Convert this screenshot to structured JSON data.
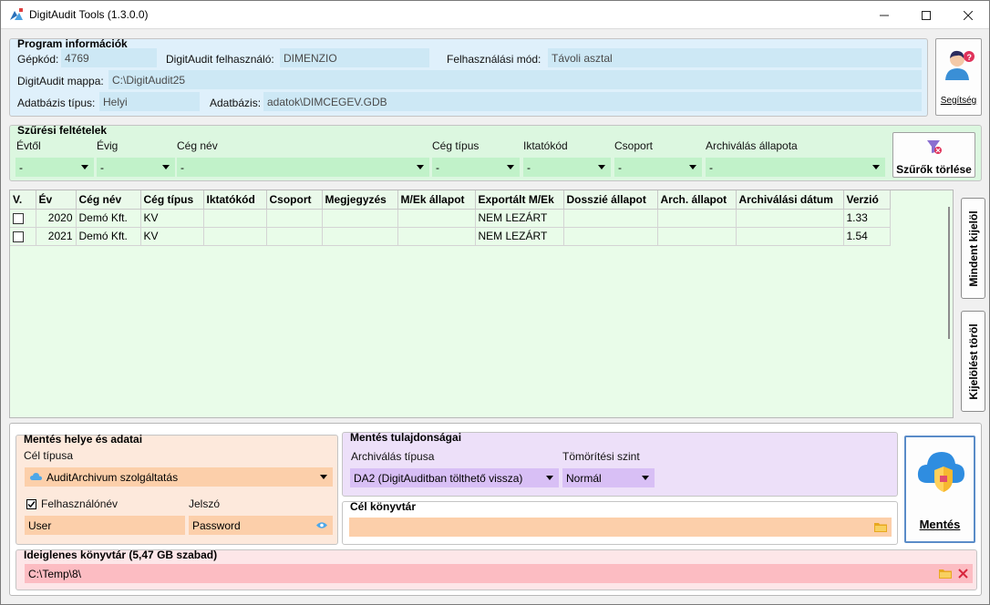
{
  "window": {
    "title": "DigitAudit Tools (1.3.0.0)"
  },
  "program_info": {
    "group_label": "Program információk",
    "machine_code_label": "Gépkód:",
    "machine_code": "4769",
    "user_label": "DigitAudit felhasználó:",
    "user": "DIMENZIO",
    "mode_label": "Felhasználási mód:",
    "mode": "Távoli asztal",
    "folder_label": "DigitAudit mappa:",
    "folder": "C:\\DigitAudit25",
    "db_type_label": "Adatbázis típus:",
    "db_type": "Helyi",
    "db_label": "Adatbázis:",
    "db": "adatok\\DIMCEGEV.GDB"
  },
  "help_button": {
    "label": "Segítség",
    "icon": "person-question-icon"
  },
  "filters": {
    "group_label": "Szűrési feltételek",
    "from_year_label": "Évtől",
    "from_year": "-",
    "to_year_label": "Évig",
    "to_year": "-",
    "company_label": "Cég név",
    "company": "-",
    "company_type_label": "Cég típus",
    "company_type": "-",
    "filing_code_label": "Iktatókód",
    "filing_code": "-",
    "group_filter_label": "Csoport",
    "group_filter": "-",
    "archive_status_label": "Archiválás állapota",
    "archive_status": "-",
    "clear_button": "Szűrők törlése"
  },
  "grid": {
    "columns": [
      "V.",
      "Év",
      "Cég név",
      "Cég típus",
      "Iktatókód",
      "Csoport",
      "Megjegyzés",
      "M/Ek állapot",
      "Exportált M/Ek",
      "Dosszié állapot",
      "Arch. állapot",
      "Archiválási dátum",
      "Verzió"
    ],
    "rows": [
      {
        "year": "2020",
        "company": "Demó Kft.",
        "type": "KV",
        "code": "",
        "group": "",
        "note": "",
        "mek_status": "",
        "exported": "NEM LEZÁRT",
        "dossier": "",
        "arch_status": "",
        "arch_date": "",
        "version": "1.33"
      },
      {
        "year": "2021",
        "company": "Demó Kft.",
        "type": "KV",
        "code": "",
        "group": "",
        "note": "",
        "mek_status": "",
        "exported": "NEM LEZÁRT",
        "dossier": "",
        "arch_status": "",
        "arch_date": "",
        "version": "1.54"
      }
    ],
    "select_all_button": "Mindent kijelöl",
    "clear_selection_button": "Kijelölést töröl"
  },
  "save_location": {
    "group_label": "Mentés helye és adatai",
    "target_type_label": "Cél típusa",
    "target_type": "AuditArchivum szolgáltatás",
    "username_checkbox_label": "Felhasználónév",
    "password_label": "Jelszó",
    "username": "User",
    "password": "Password"
  },
  "save_props": {
    "group_label": "Mentés tulajdonságai",
    "archive_type_label": "Archiválás típusa",
    "archive_type": "DA2 (DigitAuditban tölthető vissza)",
    "compression_label": "Tömörítési szint",
    "compression": "Normál"
  },
  "target_dir": {
    "group_label": "Cél könyvtár",
    "value": ""
  },
  "save_button": {
    "label": "Mentés",
    "icon": "cloud-upload-icon"
  },
  "temp_dir": {
    "group_label": "Ideiglenes könyvtár (5,47 GB szabad)",
    "value": "C:\\Temp\\8\\"
  }
}
